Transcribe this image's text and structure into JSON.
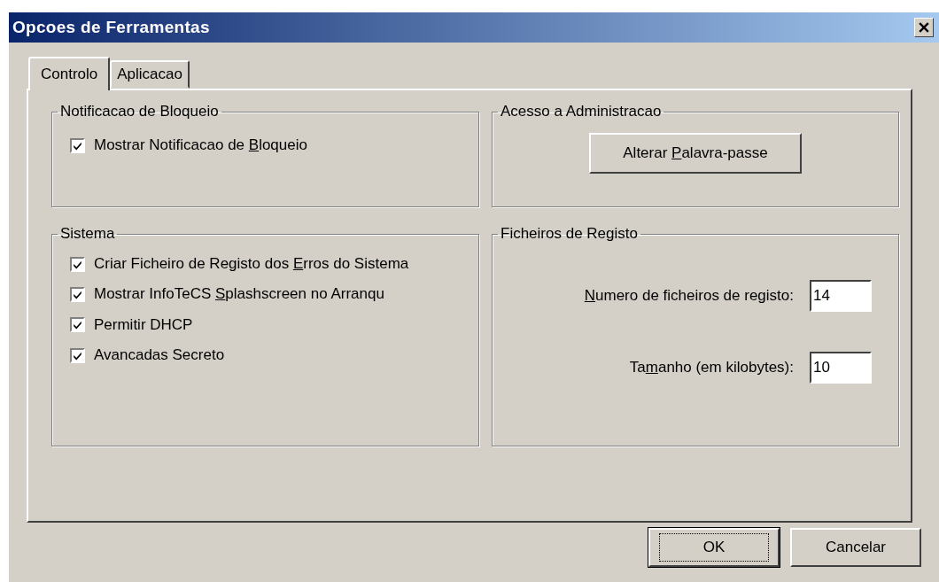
{
  "window": {
    "title": "Opcoes de Ferramentas"
  },
  "tabs": [
    {
      "label": "Controlo",
      "selected": true
    },
    {
      "label": "Aplicacao",
      "selected": false
    }
  ],
  "groups": {
    "notification": {
      "title": "Notificacao de Bloqueio",
      "options": [
        {
          "label_parts": {
            "before": "Mostrar Notificacao de ",
            "key": "B",
            "after": "loqueio"
          },
          "checked": true
        }
      ]
    },
    "admin": {
      "title": "Acesso a Administracao",
      "button_parts": {
        "before": "Alterar ",
        "key": "P",
        "after": "alavra-passe"
      }
    },
    "system": {
      "title": "Sistema",
      "options": [
        {
          "label_parts": {
            "before": "Criar Ficheiro de Registo dos ",
            "key": "E",
            "after": "rros do Sistema"
          },
          "checked": true
        },
        {
          "label_parts": {
            "before": "Mostrar InfoTeCS ",
            "key": "S",
            "after": "plashscreen no Arranqu"
          },
          "checked": true
        },
        {
          "label_parts": {
            "before": "Permitir DHCP"
          },
          "checked": true
        },
        {
          "label_parts": {
            "before": "Avancadas Secreto"
          },
          "checked": true
        }
      ]
    },
    "logs": {
      "title": "Ficheiros de Registo",
      "fields": [
        {
          "label_parts": {
            "key": "N",
            "after": "umero de ficheiros de registo:"
          },
          "value": "14"
        },
        {
          "label_parts": {
            "before": "Ta",
            "key": "m",
            "after": "anho (em kilobytes):"
          },
          "value": "10"
        }
      ]
    }
  },
  "buttons": [
    {
      "label": "OK",
      "default": true
    },
    {
      "label": "Cancelar",
      "default": false
    }
  ]
}
